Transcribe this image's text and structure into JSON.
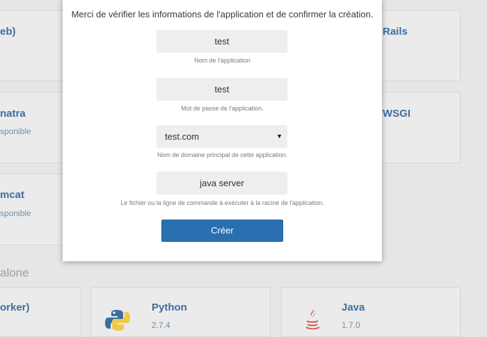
{
  "background": {
    "cards": [
      {
        "title": "eb)",
        "subtitle": ""
      },
      {
        "title": "Rails",
        "subtitle": ""
      },
      {
        "title": "natra",
        "subtitle": "sponible"
      },
      {
        "title": "WSGI",
        "subtitle": ""
      },
      {
        "title": "mcat",
        "subtitle": "sponible"
      },
      {
        "title": "orker)",
        "subtitle": ""
      },
      {
        "title": "Python",
        "subtitle": "2.7.4"
      },
      {
        "title": "Java",
        "subtitle": "1.7.0"
      }
    ],
    "section_heading": "alone",
    "icons": [
      "python-icon",
      "java-icon"
    ]
  },
  "modal": {
    "message": "Merci de vérifier les informations de l'application et de confirmer la création.",
    "fields": [
      {
        "value": "test",
        "help": "Nom de l'application"
      },
      {
        "value": "test",
        "help": "Mot de passe de l'application."
      },
      {
        "value": "test.com",
        "help": "Nom de domaine principal de cette application."
      },
      {
        "value": "java server",
        "help": "Le fichier ou la ligne de commande à exécuter à la racine de l'application."
      }
    ],
    "select_arrow": "▼",
    "create_label": "Créer"
  }
}
